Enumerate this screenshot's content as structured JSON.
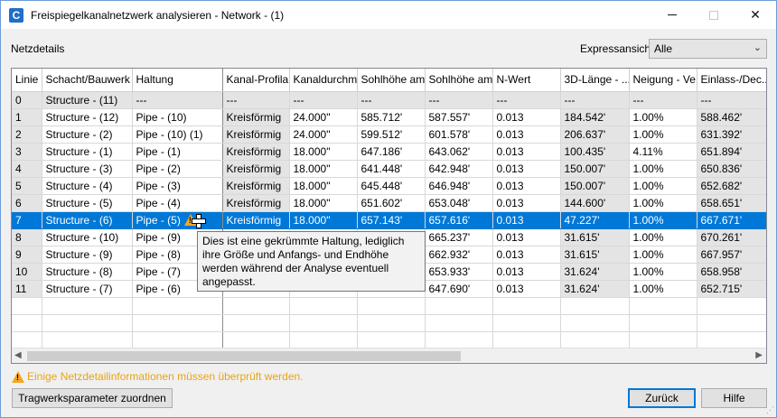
{
  "window": {
    "title": "Freispiegelkanalnetzwerk analysieren - Network - (1)",
    "app_icon_letter": "C",
    "accent": "#0078d7"
  },
  "toolbar": {
    "netzdetails_label": "Netzdetails",
    "expressansicht_label": "Expressansicht",
    "expressansicht_value": "Alle"
  },
  "grid": {
    "columns": [
      "Linie",
      "Schacht/Bauwerk",
      "Haltung",
      "Kanal-Profilart",
      "Kanaldurchm...",
      "Sohlhöhe am...",
      "Sohlhöhe am...",
      "N-Wert",
      "3D-Länge - ...",
      "Neigung - Ve...",
      "Einlass-/Dec..."
    ],
    "rows": [
      [
        "0",
        "Structure - (11)",
        "---",
        "---",
        "---",
        "---",
        "---",
        "---",
        "---",
        "---",
        "---"
      ],
      [
        "1",
        "Structure - (12)",
        "Pipe - (10)",
        "Kreisförmig",
        "24.000\"",
        "585.712'",
        "587.557'",
        "0.013",
        "184.542'",
        "1.00%",
        "588.462'"
      ],
      [
        "2",
        "Structure - (2)",
        "Pipe - (10) (1)",
        "Kreisförmig",
        "24.000\"",
        "599.512'",
        "601.578'",
        "0.013",
        "206.637'",
        "1.00%",
        "631.392'"
      ],
      [
        "3",
        "Structure - (1)",
        "Pipe - (1)",
        "Kreisförmig",
        "18.000\"",
        "647.186'",
        "643.062'",
        "0.013",
        "100.435'",
        "4.11%",
        "651.894'"
      ],
      [
        "4",
        "Structure - (3)",
        "Pipe - (2)",
        "Kreisförmig",
        "18.000\"",
        "641.448'",
        "642.948'",
        "0.013",
        "150.007'",
        "1.00%",
        "650.836'"
      ],
      [
        "5",
        "Structure - (4)",
        "Pipe - (3)",
        "Kreisförmig",
        "18.000\"",
        "645.448'",
        "646.948'",
        "0.013",
        "150.007'",
        "1.00%",
        "652.682'"
      ],
      [
        "6",
        "Structure - (5)",
        "Pipe - (4)",
        "Kreisförmig",
        "18.000\"",
        "651.602'",
        "653.048'",
        "0.013",
        "144.600'",
        "1.00%",
        "658.651'"
      ],
      [
        "7",
        "Structure - (6)",
        "Pipe - (5)",
        "Kreisförmig",
        "18.000\"",
        "657.143'",
        "657.616'",
        "0.013",
        "47.227'",
        "1.00%",
        "667.671'"
      ],
      [
        "8",
        "Structure - (10)",
        "Pipe - (9)",
        "",
        "",
        "",
        "665.237'",
        "0.013",
        "31.615'",
        "1.00%",
        "670.261'"
      ],
      [
        "9",
        "Structure - (9)",
        "Pipe - (8)",
        "",
        "",
        "",
        "662.932'",
        "0.013",
        "31.615'",
        "1.00%",
        "667.957'"
      ],
      [
        "10",
        "Structure - (8)",
        "Pipe - (7)",
        "",
        "",
        "",
        "653.933'",
        "0.013",
        "31.624'",
        "1.00%",
        "658.958'"
      ],
      [
        "11",
        "Structure - (7)",
        "Pipe - (6)",
        "",
        "",
        "",
        "647.690'",
        "0.013",
        "31.624'",
        "1.00%",
        "652.715'"
      ]
    ],
    "selected_row_index": 7
  },
  "tooltip": {
    "text": "Dies ist eine gekrümmte Haltung, lediglich ihre Größe und Anfangs- und Endhöhe werden während der Analyse eventuell angepasst."
  },
  "footer": {
    "warning_text": "Einige Netzdetailinformationen müssen überprüft werden.",
    "warning_color": "#e8a317",
    "assign_button": "Tragwerksparameter zuordnen",
    "back_button": "Zurück",
    "help_button": "Hilfe"
  }
}
